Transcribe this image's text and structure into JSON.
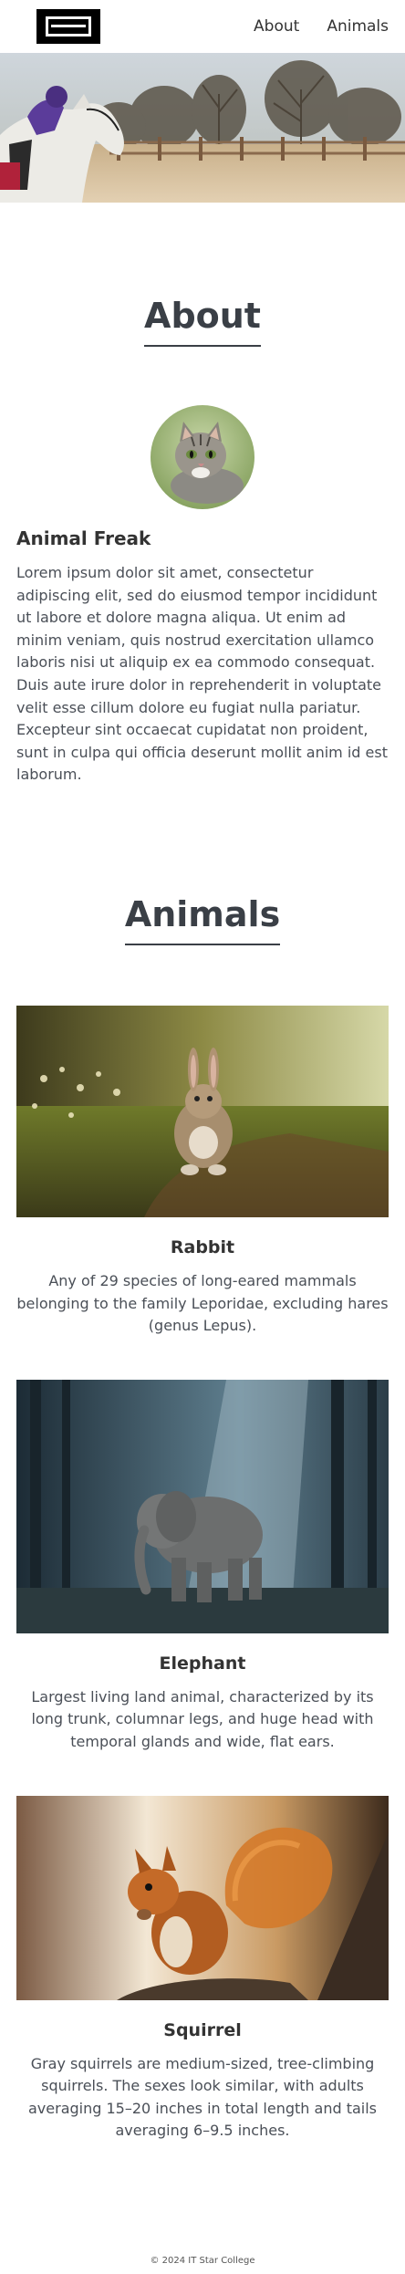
{
  "header": {
    "nav": [
      {
        "label": "About"
      },
      {
        "label": "Animals"
      }
    ]
  },
  "about": {
    "title": "About",
    "name": "Animal Freak",
    "text": "Lorem ipsum dolor sit amet, consectetur adipiscing elit, sed do eiusmod tempor incididunt ut labore et dolore magna aliqua. Ut enim ad minim veniam, quis nostrud exercitation ullamco laboris nisi ut aliquip ex ea commodo consequat. Duis aute irure dolor in reprehenderit in voluptate velit esse cillum dolore eu fugiat nulla pariatur. Excepteur sint occaecat cupidatat non proident, sunt in culpa qui officia deserunt mollit anim id est laborum."
  },
  "animals": {
    "title": "Animals",
    "items": [
      {
        "name": "Rabbit",
        "description": "Any of 29 species of long-eared mammals belonging to the family Leporidae, excluding hares (genus Lepus)."
      },
      {
        "name": "Elephant",
        "description": "Largest living land animal, characterized by its long trunk, columnar legs, and huge head with temporal glands and wide, flat ears."
      },
      {
        "name": "Squirrel",
        "description": "Gray squirrels are medium-sized, tree-climbing squirrels. The sexes look similar, with adults averaging 15–20 inches in total length and tails averaging 6–9.5 inches."
      }
    ]
  },
  "footer": {
    "text": "© 2024 IT Star College"
  }
}
